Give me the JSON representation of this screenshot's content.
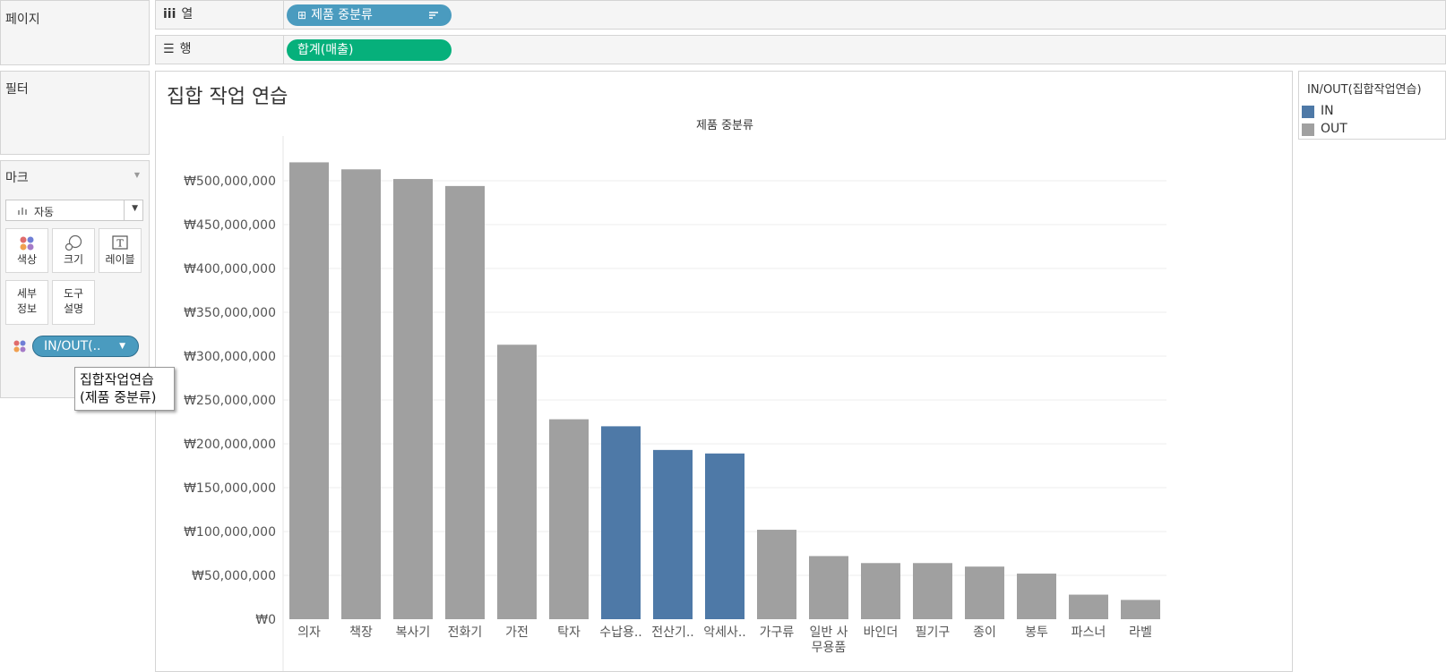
{
  "pages": {
    "title": "페이지"
  },
  "filters": {
    "title": "필터"
  },
  "marks": {
    "title": "마크",
    "type": "자동",
    "buttons": {
      "color": "색상",
      "size": "크기",
      "label": "레이블",
      "detail": "세부\n정보",
      "tooltip": "도구\n설명"
    },
    "detail_line1": "세부",
    "detail_line2": "정보",
    "tooltip_line1": "도구",
    "tooltip_line2": "설명",
    "color_pill": "IN/OUT(.."
  },
  "shelves": {
    "columns": {
      "label": "열",
      "pill": "제품 중분류",
      "pill_color": "#4a9bbf"
    },
    "rows": {
      "label": "행",
      "pill": "합계(매출)",
      "pill_color": "#06b07b"
    }
  },
  "drag_tooltip": {
    "line1": "집합작업연습",
    "line2": "(제품 중분류)"
  },
  "legend": {
    "title": "IN/OUT(집합작업연습)",
    "items": [
      {
        "label": "IN",
        "color": "#4e79a7"
      },
      {
        "label": "OUT",
        "color": "#a0a0a0"
      }
    ]
  },
  "sheet_title": "집합 작업 연습",
  "chart_data": {
    "type": "bar",
    "column_header": "제품 중분류",
    "categories": [
      "의자",
      "책장",
      "복사기",
      "전화기",
      "가전",
      "탁자",
      "수납용..",
      "전산기..",
      "악세사..",
      "가구류",
      "일반 사\n무용품",
      "바인더",
      "필기구",
      "종이",
      "봉투",
      "파스너",
      "라벨"
    ],
    "values": [
      521000000,
      513000000,
      502000000,
      494000000,
      313000000,
      228000000,
      220000000,
      193000000,
      189000000,
      102000000,
      72000000,
      64000000,
      64000000,
      60000000,
      52000000,
      28000000,
      22000000
    ],
    "set": [
      "OUT",
      "OUT",
      "OUT",
      "OUT",
      "OUT",
      "OUT",
      "IN",
      "IN",
      "IN",
      "OUT",
      "OUT",
      "OUT",
      "OUT",
      "OUT",
      "OUT",
      "OUT",
      "OUT"
    ],
    "ylim": [
      0,
      500000000
    ],
    "ytick_labels": [
      "₩0",
      "₩50,000,000",
      "₩100,000,000",
      "₩150,000,000",
      "₩200,000,000",
      "₩250,000,000",
      "₩300,000,000",
      "₩350,000,000",
      "₩400,000,000",
      "₩450,000,000",
      "₩500,000,000"
    ],
    "grid": true
  }
}
